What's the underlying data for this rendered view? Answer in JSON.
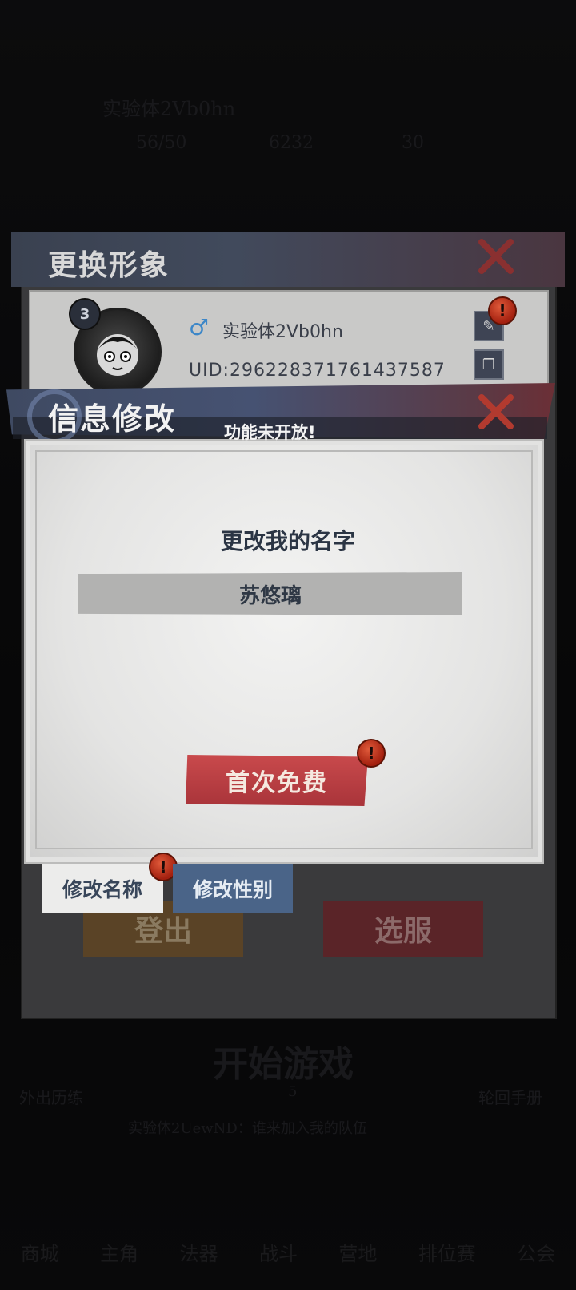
{
  "background": {
    "player_name": "实验体2Vb0hn",
    "stat_1": "56/50",
    "stat_2": "6232",
    "stat_3": "30",
    "start_game": "开始游戏",
    "start_cost": "5",
    "side_left": "外出历练",
    "side_right": "轮回手册",
    "chat_line": "实验体2UewND：谁来加入我的队伍",
    "bottom_nav": [
      "商城",
      "主角",
      "法器",
      "战斗",
      "营地",
      "排位赛",
      "公会"
    ]
  },
  "outer_panel": {
    "title": "更换形象",
    "profile": {
      "level": "3",
      "gender_symbol": "♂",
      "nickname": "实验体2Vb0hn",
      "uid": "UID:296228371761437587"
    },
    "buttons": {
      "logout": "登出",
      "select_server": "选服"
    }
  },
  "modal": {
    "title": "信息修改",
    "toast": "功能未开放!",
    "heading": "更改我的名字",
    "name_value": "苏悠璃",
    "free_button": "首次免费",
    "tabs": [
      {
        "label": "修改名称",
        "active": true
      },
      {
        "label": "修改性别",
        "active": false
      }
    ]
  },
  "icons": {
    "close": "close-icon",
    "edit": "edit-icon",
    "copy": "copy-icon",
    "alert": "alert-icon"
  },
  "colors": {
    "accent_red": "#a9343a",
    "tab_blue": "#4a6488",
    "header_blue": "#465272"
  }
}
